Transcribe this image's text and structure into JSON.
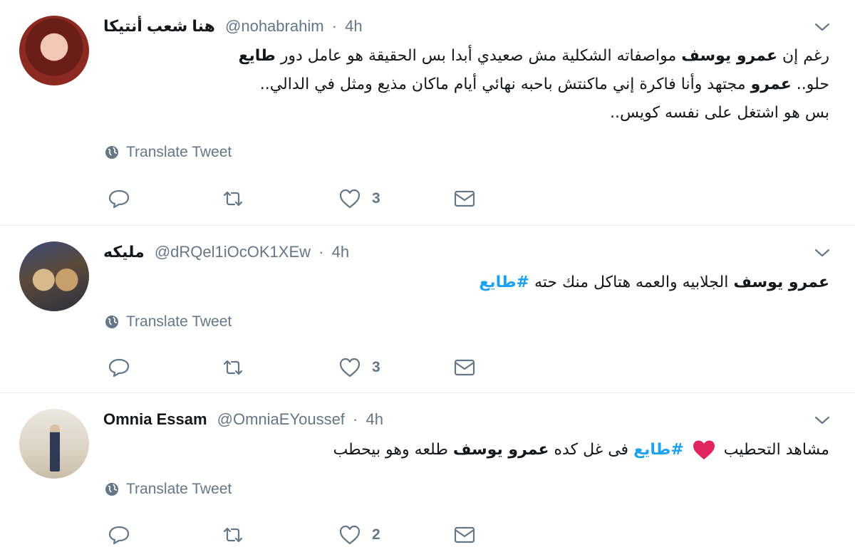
{
  "tweets": [
    {
      "name": "هنا شعب أنتيكا",
      "handle": "@nohabrahim",
      "separator": "·",
      "time": "4h",
      "lines": [
        [
          "رغم إن ",
          {
            "b": "عمرو يوسف"
          },
          " مواصفاته الشكلية مش صعيدي أبدا بس الحقيقة هو عامل دور ",
          {
            "b": "طايع"
          }
        ],
        [
          "حلو.. ",
          {
            "b": "عمرو"
          },
          " مجتهد وأنا فاكرة إني ماكنتش باحبه نهائي أيام ماكان مذيع ومثل في الدالي.."
        ],
        [
          "بس هو اشتغل على نفسه كويس.."
        ]
      ],
      "translate_label": "Translate Tweet",
      "like_count": "3"
    },
    {
      "name": "مليكه",
      "handle": "@dRQel1iOcOK1XEw",
      "separator": "·",
      "time": "4h",
      "lines": [
        [
          {
            "b": "عمرو يوسف"
          },
          " الجلابيه والعمه هتاكل منك حته ",
          {
            "tag": "#طايع"
          }
        ]
      ],
      "translate_label": "Translate Tweet",
      "like_count": "3"
    },
    {
      "name": "Omnia Essam",
      "handle": "@OmniaEYoussef",
      "separator": "·",
      "time": "4h",
      "lines": [
        [
          "مشاهد التحطيب ",
          {
            "emoji": "heart"
          },
          " ",
          {
            "tag": "#طايع"
          },
          " فى غل كده ",
          {
            "b": "عمرو يوسف"
          },
          " طلعه وهو بيحطب"
        ]
      ],
      "translate_label": "Translate Tweet",
      "like_count": "2"
    }
  ],
  "colors": {
    "text": "#14171a",
    "secondary": "#657786",
    "link": "#1da1f2",
    "divider": "#e6ecf0",
    "heart_emoji": "#e0245e"
  },
  "icons": {
    "caret": "chevron-down-icon",
    "translate": "globe-icon",
    "reply": "reply-icon",
    "retweet": "retweet-icon",
    "like": "heart-icon",
    "dm": "envelope-icon"
  }
}
